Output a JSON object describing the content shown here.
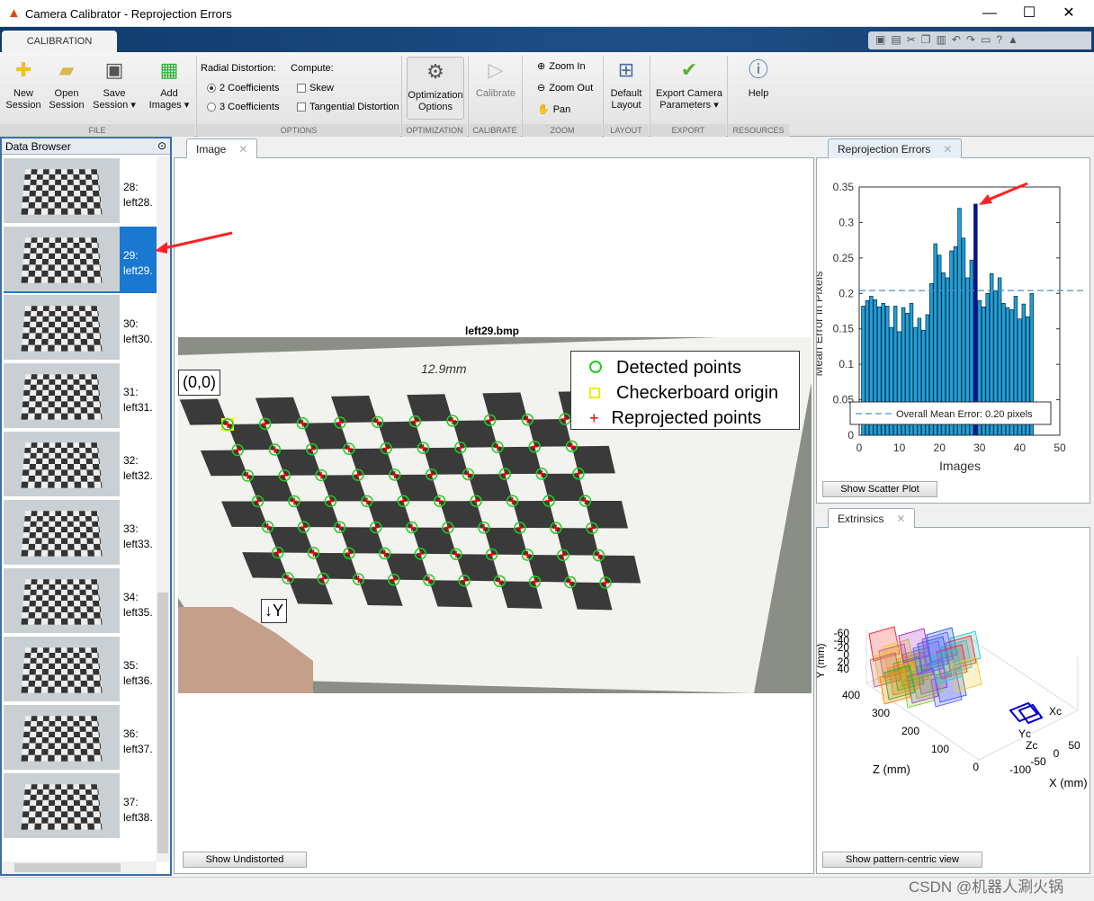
{
  "window": {
    "title": "Camera Calibrator - Reprojection Errors",
    "minimize": "—",
    "maximize": "☐",
    "close": "✕"
  },
  "ribbon": {
    "tab": "CALIBRATION",
    "file": {
      "new": "New Session",
      "open": "Open Session",
      "save": "Save Session ▾",
      "add": "Add Images ▾",
      "group": "FILE"
    },
    "options": {
      "radial_label": "Radial Distortion:",
      "opt2": "2 Coefficients",
      "opt3": "3 Coefficients",
      "radial_selected": "2 Coefficients",
      "compute_label": "Compute:",
      "skew": "Skew",
      "tangential": "Tangential Distortion",
      "skew_checked": false,
      "tangential_checked": false,
      "group": "OPTIONS"
    },
    "optimization": {
      "label": "Optimization Options",
      "group": "OPTIMIZATION"
    },
    "calibrate": {
      "label": "Calibrate",
      "group": "CALIBRATE"
    },
    "zoom": {
      "in": "Zoom In",
      "out": "Zoom Out",
      "pan": "Pan",
      "group": "ZOOM"
    },
    "layout": {
      "label": "Default Layout",
      "group": "LAYOUT"
    },
    "export": {
      "label": "Export Camera Parameters ▾",
      "group": "EXPORT"
    },
    "help": {
      "label": "Help",
      "group": "RESOURCES"
    }
  },
  "browser": {
    "title": "Data Browser",
    "items": [
      {
        "num": "28:",
        "name": "left28."
      },
      {
        "num": "29:",
        "name": "left29."
      },
      {
        "num": "30:",
        "name": "left30."
      },
      {
        "num": "31:",
        "name": "left31."
      },
      {
        "num": "32:",
        "name": "left32."
      },
      {
        "num": "33:",
        "name": "left33."
      },
      {
        "num": "34:",
        "name": "left35."
      },
      {
        "num": "35:",
        "name": "left36."
      },
      {
        "num": "36:",
        "name": "left37."
      },
      {
        "num": "37:",
        "name": "left38."
      }
    ],
    "selected": "29:"
  },
  "image_panel": {
    "tab": "Image",
    "image_title": "left29.bmp",
    "origin_label": "(0,0)",
    "y_label": "↓Y",
    "handwriting": "12.9mm",
    "legend": [
      "Detected points",
      "Checkerboard origin",
      "Reprojected points"
    ],
    "show_undistorted": "Show Undistorted"
  },
  "reproj_panel": {
    "tab": "Reprojection Errors",
    "button": "Show Scatter Plot"
  },
  "extrinsics_panel": {
    "tab": "Extrinsics",
    "button": "Show pattern-centric view",
    "y_label": "Y (mm)",
    "z_label": "Z (mm)",
    "x_label": "X (mm)",
    "y_ticks": [
      "-60",
      "-40",
      "-20",
      "0",
      "20",
      "40"
    ],
    "z_ticks": [
      "400",
      "300",
      "200",
      "100",
      "0"
    ],
    "x_ticks": [
      "-100",
      "-50",
      "0",
      "50"
    ],
    "cam_labels": [
      "Xc",
      "Yc",
      "Zc"
    ]
  },
  "chart_data": {
    "type": "bar",
    "ylabel": "Mean Error in Pixels",
    "xlabel": "Images",
    "xlim": [
      0,
      50
    ],
    "ylim": [
      0,
      0.35
    ],
    "xticks": [
      "0",
      "10",
      "20",
      "30",
      "40",
      "50"
    ],
    "yticks": [
      "0",
      "0.05",
      "0.1",
      "0.15",
      "0.2",
      "0.25",
      "0.3",
      "0.35"
    ],
    "x": [
      1,
      2,
      3,
      4,
      5,
      6,
      7,
      8,
      9,
      10,
      11,
      12,
      13,
      14,
      15,
      16,
      17,
      18,
      19,
      20,
      21,
      22,
      23,
      24,
      25,
      26,
      27,
      28,
      29,
      30,
      31,
      32,
      33,
      34,
      35,
      36,
      37,
      38,
      39,
      40,
      41,
      42,
      43
    ],
    "values": [
      0.182,
      0.19,
      0.196,
      0.191,
      0.181,
      0.186,
      0.182,
      0.152,
      0.182,
      0.146,
      0.18,
      0.172,
      0.186,
      0.152,
      0.165,
      0.148,
      0.17,
      0.214,
      0.27,
      0.254,
      0.229,
      0.222,
      0.26,
      0.266,
      0.32,
      0.278,
      0.222,
      0.247,
      0.326,
      0.19,
      0.181,
      0.2,
      0.228,
      0.204,
      0.222,
      0.186,
      0.18,
      0.177,
      0.196,
      0.164,
      0.185,
      0.167,
      0.2
    ],
    "highlighted": 29,
    "mean": 0.204,
    "legend": "Overall Mean Error: 0.20 pixels",
    "legend_position": "bottom",
    "bar_color": "#1ea0dc",
    "highlight_color": "#0a0fa8",
    "mean_color": "#4a90c8"
  },
  "watermark": "CSDN @机器人涮火锅"
}
